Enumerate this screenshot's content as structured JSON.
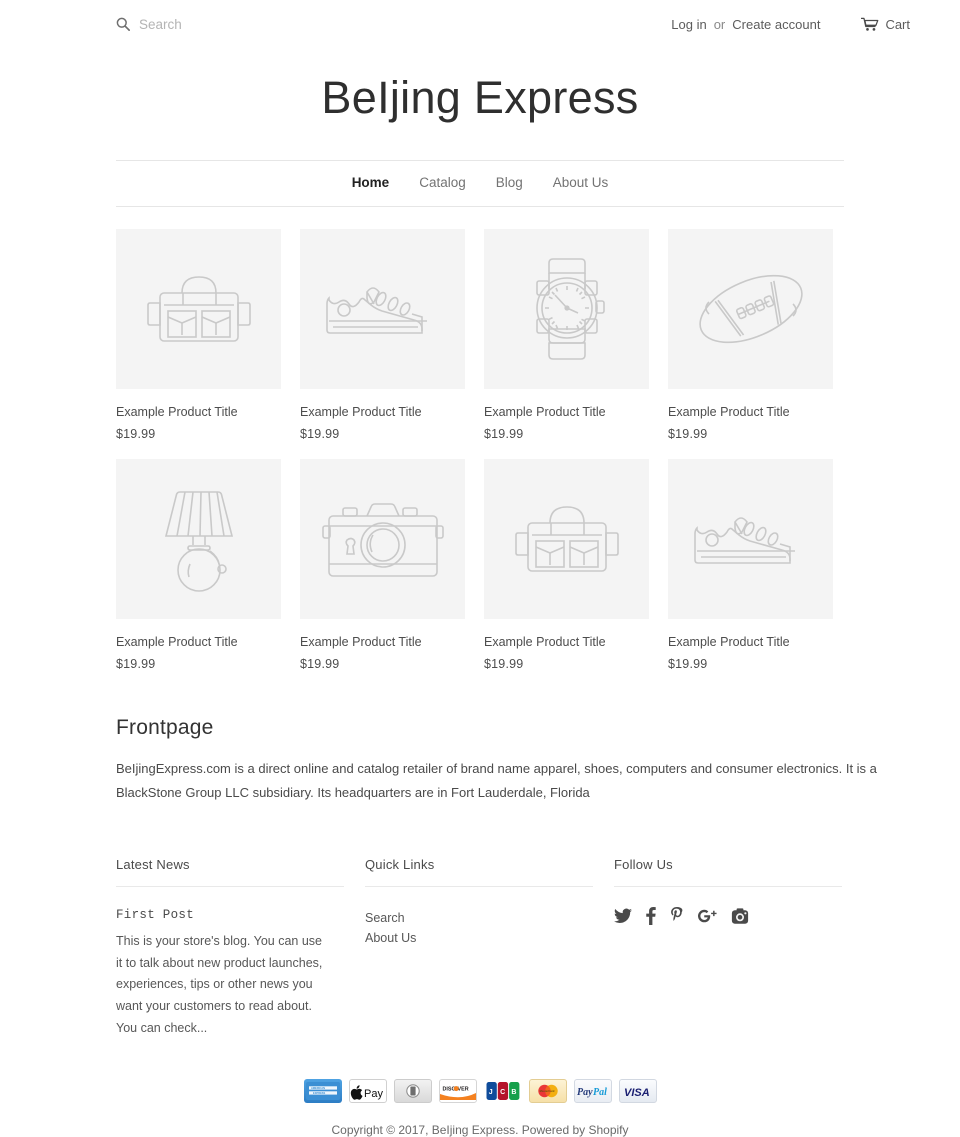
{
  "header": {
    "search": {
      "placeholder": "Search",
      "value": "",
      "icon": "search-icon"
    },
    "login_label": "Log in",
    "or_label": "or",
    "create_account_label": "Create account",
    "cart_label": "Cart",
    "cart_icon": "shopping-cart-icon",
    "site_title": "BeIjing Express"
  },
  "nav": {
    "items": [
      {
        "label": "Home",
        "active": true
      },
      {
        "label": "Catalog",
        "active": false
      },
      {
        "label": "Blog",
        "active": false
      },
      {
        "label": "About Us",
        "active": false
      }
    ]
  },
  "products": [
    {
      "title": "Example Product Title",
      "price": "$19.99",
      "icon": "bag-icon"
    },
    {
      "title": "Example Product Title",
      "price": "$19.99",
      "icon": "sneaker-icon"
    },
    {
      "title": "Example Product Title",
      "price": "$19.99",
      "icon": "watch-icon"
    },
    {
      "title": "Example Product Title",
      "price": "$19.99",
      "icon": "football-icon"
    },
    {
      "title": "Example Product Title",
      "price": "$19.99",
      "icon": "lamp-icon"
    },
    {
      "title": "Example Product Title",
      "price": "$19.99",
      "icon": "camera-icon"
    },
    {
      "title": "Example Product Title",
      "price": "$19.99",
      "icon": "bag-icon"
    },
    {
      "title": "Example Product Title",
      "price": "$19.99",
      "icon": "sneaker-icon"
    }
  ],
  "main": {
    "section_title": "Frontpage",
    "body": "BeIjingExpress.com is a direct online and catalog retailer of brand name apparel, shoes, computers and consumer electronics. It is a BlackStone Group LLC subsidiary.  Its headquarters are in Fort Lauderdale, Florida"
  },
  "footer": {
    "news": {
      "heading": "Latest News",
      "post_title": "First Post",
      "post_excerpt": "This is your store's blog. You can use it to talk about new product launches, experiences, tips or other news you want your customers to read about. You can check..."
    },
    "quick_links": {
      "heading": "Quick Links",
      "items": [
        {
          "label": "Search"
        },
        {
          "label": "About Us"
        }
      ]
    },
    "follow": {
      "heading": "Follow Us",
      "items": [
        {
          "name": "twitter-icon",
          "label": "Twitter"
        },
        {
          "name": "facebook-icon",
          "label": "Facebook"
        },
        {
          "name": "pinterest-icon",
          "label": "Pinterest"
        },
        {
          "name": "google-plus-icon",
          "label": "Google Plus"
        },
        {
          "name": "instagram-icon",
          "label": "Instagram"
        }
      ]
    },
    "payments": [
      {
        "name": "american-express-icon",
        "label": "American Express"
      },
      {
        "name": "apple-pay-icon",
        "label": "Apple Pay"
      },
      {
        "name": "diners-club-icon",
        "label": "Diners Club"
      },
      {
        "name": "discover-icon",
        "label": "Discover"
      },
      {
        "name": "jcb-icon",
        "label": "JCB"
      },
      {
        "name": "mastercard-icon",
        "label": "Master"
      },
      {
        "name": "paypal-icon",
        "label": "PayPal"
      },
      {
        "name": "visa-icon",
        "label": "VISA"
      }
    ],
    "copyright": "Copyright © 2017, BeIjing Express. Powered by Shopify"
  },
  "colors": {
    "text": "#333333",
    "muted": "#737373",
    "thumb_bg": "#f4f4f4",
    "rule": "#e6e6e6",
    "placeholder_stroke": "#c9c9c9"
  }
}
